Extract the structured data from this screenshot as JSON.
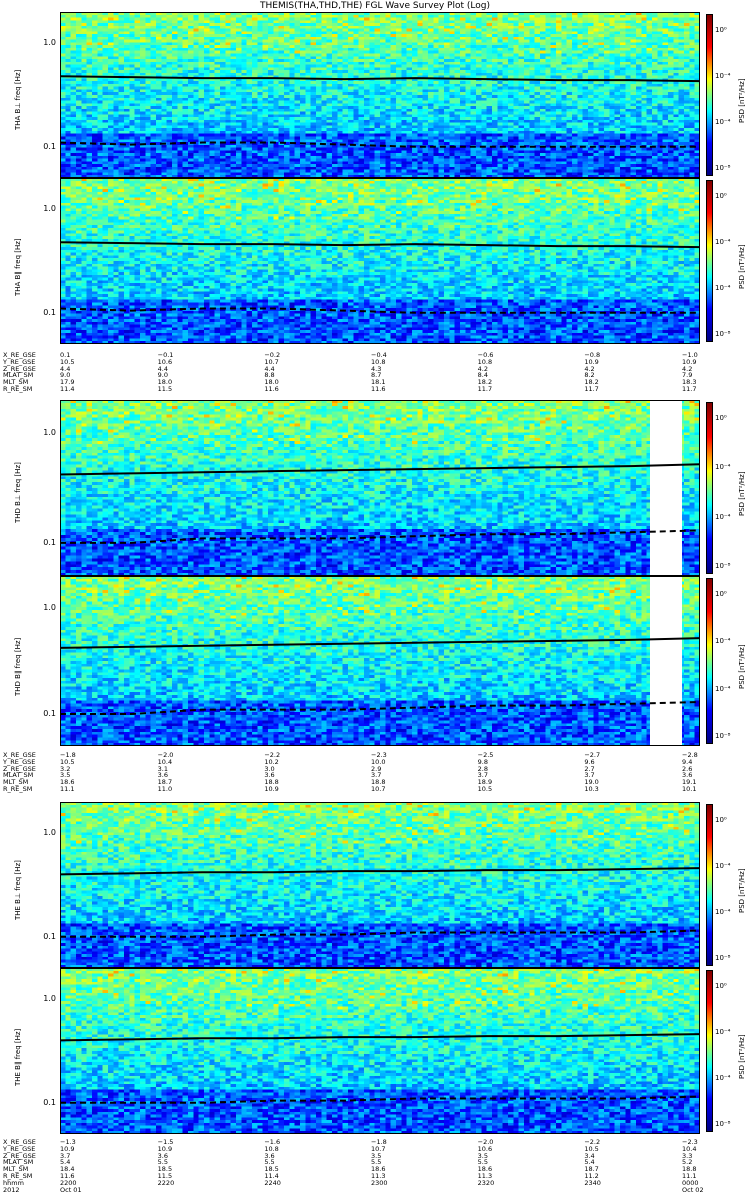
{
  "title": "THEMIS(THA,THD,THE) FGL Wave Survey Plot (Log)",
  "colorbar_ticks": [
    "10⁰",
    "10⁻⁴",
    "10⁻⁴",
    "10⁻⁸"
  ],
  "colorbar_label": "PSD [nT²/Hz]",
  "freq_ticks": [
    "1.0",
    "0.1"
  ],
  "colors": {
    "jet_low": "#000080",
    "jet_high": "#800000",
    "trace": "#000000"
  },
  "chart_data": [
    {
      "type": "heatmap",
      "probe": "THA",
      "component": "THA B⊥",
      "ylabel": "freq [Hz]",
      "yscale": "log",
      "colorbar": "PSD [nT²/Hz]",
      "fce_line": [
        0.48,
        0.47,
        0.46,
        0.46,
        0.45,
        0.46,
        0.45,
        0.44,
        0.44,
        0.43
      ],
      "fch_line": [
        0.11,
        0.105,
        0.11,
        0.11,
        0.105,
        0.1,
        0.1,
        0.1,
        0.1,
        0.1
      ]
    },
    {
      "type": "heatmap",
      "probe": "THA",
      "component": "THA B∥",
      "ylabel": "freq [Hz]",
      "yscale": "log",
      "colorbar": "PSD [nT²/Hz]",
      "fce_line": [
        0.48,
        0.47,
        0.46,
        0.46,
        0.45,
        0.46,
        0.45,
        0.44,
        0.44,
        0.43
      ],
      "fch_line": [
        0.11,
        0.105,
        0.11,
        0.11,
        0.105,
        0.1,
        0.1,
        0.1,
        0.1,
        0.1
      ]
    },
    {
      "type": "heatmap",
      "probe": "THD",
      "component": "THD B⊥",
      "ylabel": "freq [Hz]",
      "yscale": "log",
      "colorbar": "PSD [nT²/Hz]",
      "fce_line": [
        0.42,
        0.43,
        0.44,
        0.45,
        0.46,
        0.47,
        0.48,
        0.49,
        0.5,
        0.52
      ],
      "fch_line": [
        0.1,
        0.1,
        0.11,
        0.11,
        0.11,
        0.115,
        0.12,
        0.12,
        0.125,
        0.13
      ]
    },
    {
      "type": "heatmap",
      "probe": "THD",
      "component": "THD B∥",
      "ylabel": "freq [Hz]",
      "yscale": "log",
      "colorbar": "PSD [nT²/Hz]",
      "fce_line": [
        0.42,
        0.43,
        0.44,
        0.45,
        0.46,
        0.47,
        0.48,
        0.49,
        0.5,
        0.52
      ],
      "fch_line": [
        0.1,
        0.1,
        0.11,
        0.11,
        0.11,
        0.115,
        0.12,
        0.12,
        0.125,
        0.13
      ]
    },
    {
      "type": "heatmap",
      "probe": "THE",
      "component": "THE B⊥",
      "ylabel": "freq [Hz]",
      "yscale": "log",
      "colorbar": "PSD [nT²/Hz]",
      "fce_line": [
        0.4,
        0.41,
        0.42,
        0.42,
        0.43,
        0.43,
        0.44,
        0.44,
        0.45,
        0.46
      ],
      "fch_line": [
        0.1,
        0.1,
        0.1,
        0.105,
        0.105,
        0.11,
        0.11,
        0.11,
        0.11,
        0.115
      ]
    },
    {
      "type": "heatmap",
      "probe": "THE",
      "component": "THE B∥",
      "ylabel": "freq [Hz]",
      "yscale": "log",
      "colorbar": "PSD [nT²/Hz]",
      "fce_line": [
        0.4,
        0.41,
        0.42,
        0.42,
        0.43,
        0.43,
        0.44,
        0.44,
        0.45,
        0.46
      ],
      "fch_line": [
        0.1,
        0.1,
        0.1,
        0.105,
        0.105,
        0.11,
        0.11,
        0.11,
        0.11,
        0.115
      ]
    }
  ],
  "ephemeris": [
    {
      "rows": [
        {
          "name": "X_RE_GSE",
          "values": [
            "0.1",
            "−0.1",
            "−0.2",
            "−0.4",
            "−0.6",
            "−0.8",
            "−1.0"
          ]
        },
        {
          "name": "Y_RE_GSE",
          "values": [
            "10.5",
            "10.6",
            "10.7",
            "10.8",
            "10.8",
            "10.9",
            "10.9"
          ]
        },
        {
          "name": "Z_RE_GSE",
          "values": [
            "4.4",
            "4.4",
            "4.4",
            "4.3",
            "4.2",
            "4.2",
            "4.2"
          ]
        },
        {
          "name": "MLAT_SM",
          "values": [
            "9.0",
            "9.0",
            "8.8",
            "8.7",
            "8.4",
            "8.2",
            "7.9"
          ]
        },
        {
          "name": "MLT_SM",
          "values": [
            "17.9",
            "18.0",
            "18.0",
            "18.1",
            "18.2",
            "18.2",
            "18.3"
          ]
        },
        {
          "name": "R_RE_SM",
          "values": [
            "11.4",
            "11.5",
            "11.6",
            "11.6",
            "11.7",
            "11.7",
            "11.7"
          ]
        }
      ]
    },
    {
      "rows": [
        {
          "name": "X_RE_GSE",
          "values": [
            "−1.8",
            "−2.0",
            "−2.2",
            "−2.3",
            "−2.5",
            "−2.7",
            "−2.8"
          ]
        },
        {
          "name": "Y_RE_GSE",
          "values": [
            "10.5",
            "10.4",
            "10.2",
            "10.0",
            "9.8",
            "9.6",
            "9.4"
          ]
        },
        {
          "name": "Z_RE_GSE",
          "values": [
            "3.2",
            "3.1",
            "3.0",
            "2.9",
            "2.8",
            "2.7",
            "2.6"
          ]
        },
        {
          "name": "MLAT_SM",
          "values": [
            "3.5",
            "3.6",
            "3.6",
            "3.7",
            "3.7",
            "3.7",
            "3.6"
          ]
        },
        {
          "name": "MLT_SM",
          "values": [
            "18.6",
            "18.7",
            "18.8",
            "18.8",
            "18.9",
            "19.0",
            "19.1"
          ]
        },
        {
          "name": "R_RE_SM",
          "values": [
            "11.1",
            "11.0",
            "10.9",
            "10.7",
            "10.5",
            "10.3",
            "10.1"
          ]
        }
      ]
    },
    {
      "rows": [
        {
          "name": "X_RE_GSE",
          "values": [
            "−1.3",
            "−1.5",
            "−1.6",
            "−1.8",
            "−2.0",
            "−2.2",
            "−2.3"
          ]
        },
        {
          "name": "Y_RE_GSE",
          "values": [
            "10.9",
            "10.9",
            "10.8",
            "10.7",
            "10.6",
            "10.5",
            "10.4"
          ]
        },
        {
          "name": "Z_RE_GSE",
          "values": [
            "3.7",
            "3.6",
            "3.6",
            "3.5",
            "3.5",
            "3.4",
            "3.3"
          ]
        },
        {
          "name": "MLAT_SM",
          "values": [
            "5.4",
            "5.5",
            "5.5",
            "5.5",
            "5.5",
            "5.4",
            "5.2"
          ]
        },
        {
          "name": "MLT_SM",
          "values": [
            "18.4",
            "18.5",
            "18.5",
            "18.6",
            "18.6",
            "18.7",
            "18.8"
          ]
        },
        {
          "name": "R_RE_SM",
          "values": [
            "11.6",
            "11.5",
            "11.4",
            "11.3",
            "11.3",
            "11.2",
            "11.1"
          ]
        },
        {
          "name": "hhmm",
          "values": [
            "2200",
            "2220",
            "2240",
            "2300",
            "2320",
            "2340",
            "0000"
          ]
        },
        {
          "name": "2012",
          "values": [
            "Oct 01",
            "",
            "",
            "",
            "",
            "",
            "Oct 02"
          ]
        }
      ]
    }
  ]
}
